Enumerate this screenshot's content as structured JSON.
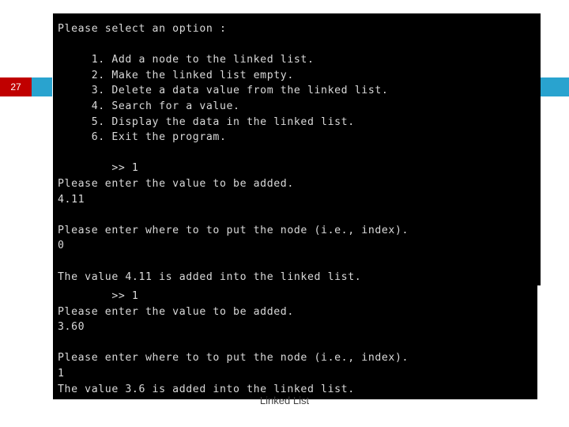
{
  "slide": {
    "number": "27",
    "caption": "Linked List",
    "accent_color": "#29a3cf",
    "number_box_color": "#c00000"
  },
  "console_top": {
    "lines": [
      "Please select an option :",
      "",
      "     1. Add a node to the linked list.",
      "     2. Make the linked list empty.",
      "     3. Delete a data value from the linked list.",
      "     4. Search for a value.",
      "     5. Display the data in the linked list.",
      "     6. Exit the program.",
      "",
      "        >> 1",
      "Please enter the value to be added.",
      "4.11",
      "",
      "Please enter where to to put the node (i.e., index).",
      "0",
      "",
      "The value 4.11 is added into the linked list.",
      ""
    ]
  },
  "console_bottom": {
    "lines": [
      "        >> 1",
      "Please enter the value to be added.",
      "3.60",
      "",
      "Please enter where to to put the node (i.e., index).",
      "1",
      "The value 3.6 is added into the linked list."
    ]
  }
}
